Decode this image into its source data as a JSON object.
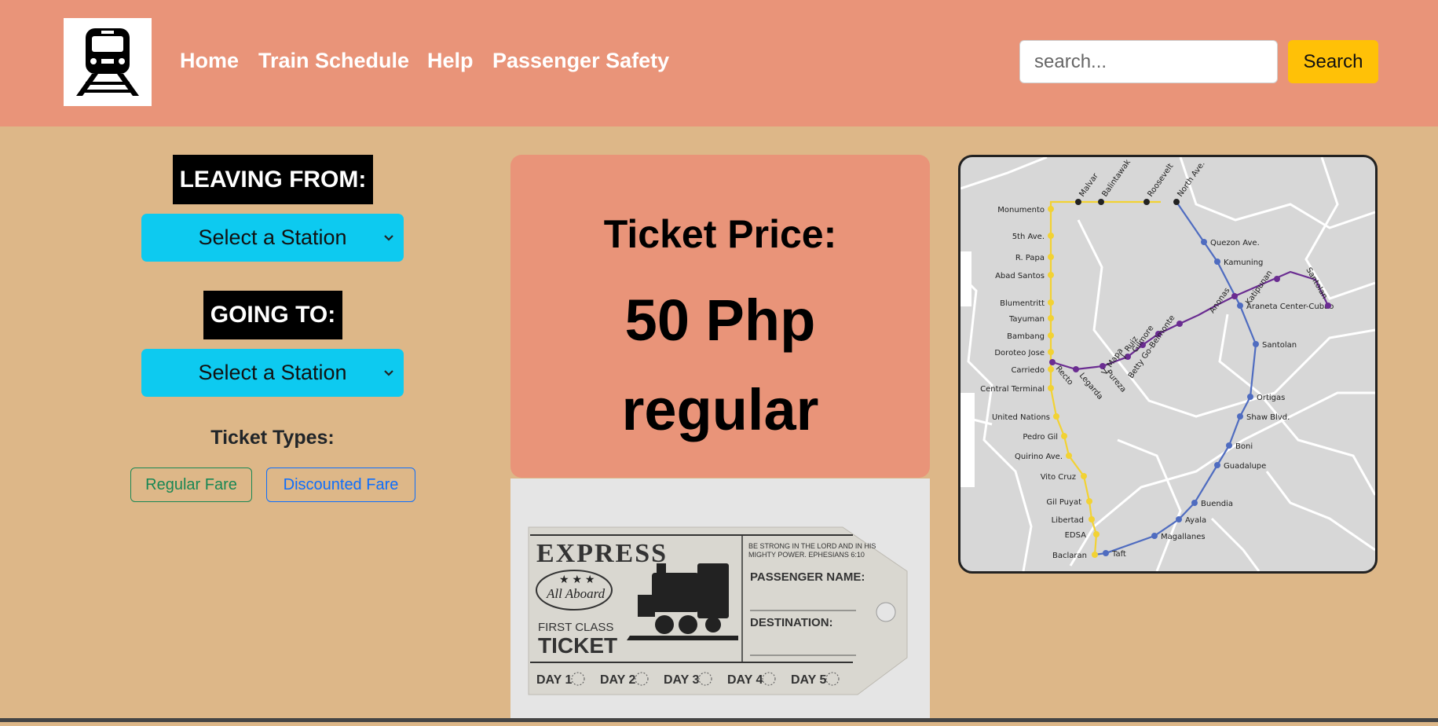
{
  "header": {
    "nav": [
      "Home",
      "Train Schedule",
      "Help",
      "Passenger Safety"
    ],
    "search_placeholder": "search...",
    "search_button": "Search",
    "logo_icon": "train-icon"
  },
  "booking": {
    "leaving_label": "LEAVING FROM:",
    "leaving_select": "Select a Station",
    "going_label": "GOING TO:",
    "going_select": "Select a Station",
    "ticket_types_title": "Ticket Types:",
    "fare_regular": "Regular Fare",
    "fare_discounted": "Discounted Fare",
    "colors": {
      "select_bg": "#0DCAF0",
      "regular": "#198754",
      "discounted": "#0D6EFD"
    }
  },
  "price": {
    "title": "Ticket Price:",
    "value": "50 Php",
    "type": "regular"
  },
  "ticket_image": {
    "express": "EXPRESS",
    "verse": "BE STRONG IN THE LORD AND IN HIS MIGHTY POWER. EPHESIANS 6:10",
    "all_aboard": "All Aboard",
    "first_class": "FIRST CLASS",
    "ticket": "TICKET",
    "passenger_name": "PASSENGER NAME:",
    "destination": "DESTINATION:",
    "days": [
      "DAY 1",
      "DAY 2",
      "DAY 3",
      "DAY 4",
      "DAY 5"
    ]
  },
  "map": {
    "yellow_line": [
      "Monumento",
      "5th Ave.",
      "R. Papa",
      "Abad Santos",
      "Blumentritt",
      "Tayuman",
      "Bambang",
      "Doroteo Jose",
      "Carriedo",
      "Central Terminal",
      "United Nations",
      "Pedro Gil",
      "Quirino Ave.",
      "Vito Cruz",
      "Gil Puyat",
      "Libertad",
      "EDSA",
      "Baclaran"
    ],
    "top_stations": [
      "Malvar",
      "Balintawak",
      "Roosevelt",
      "North Ave."
    ],
    "blue_line": [
      "North Ave.",
      "Quezon Ave.",
      "Kamuning",
      "Araneta Center-Cubao",
      "Santolan",
      "Ortigas",
      "Shaw Blvd.",
      "Boni",
      "Guadalupe",
      "Buendia",
      "Ayala",
      "Magallanes",
      "Taft"
    ],
    "purple_line": [
      "Recto",
      "Legarda",
      "Pureza",
      "V. Mapa",
      "J. Ruiz",
      "Gilmore",
      "Betty Go-Belmonte",
      "Anonas",
      "Katipunan",
      "Santolan"
    ],
    "colors": {
      "yellow": "#F2D233",
      "blue": "#4F6CC0",
      "purple": "#6A2C91"
    }
  }
}
